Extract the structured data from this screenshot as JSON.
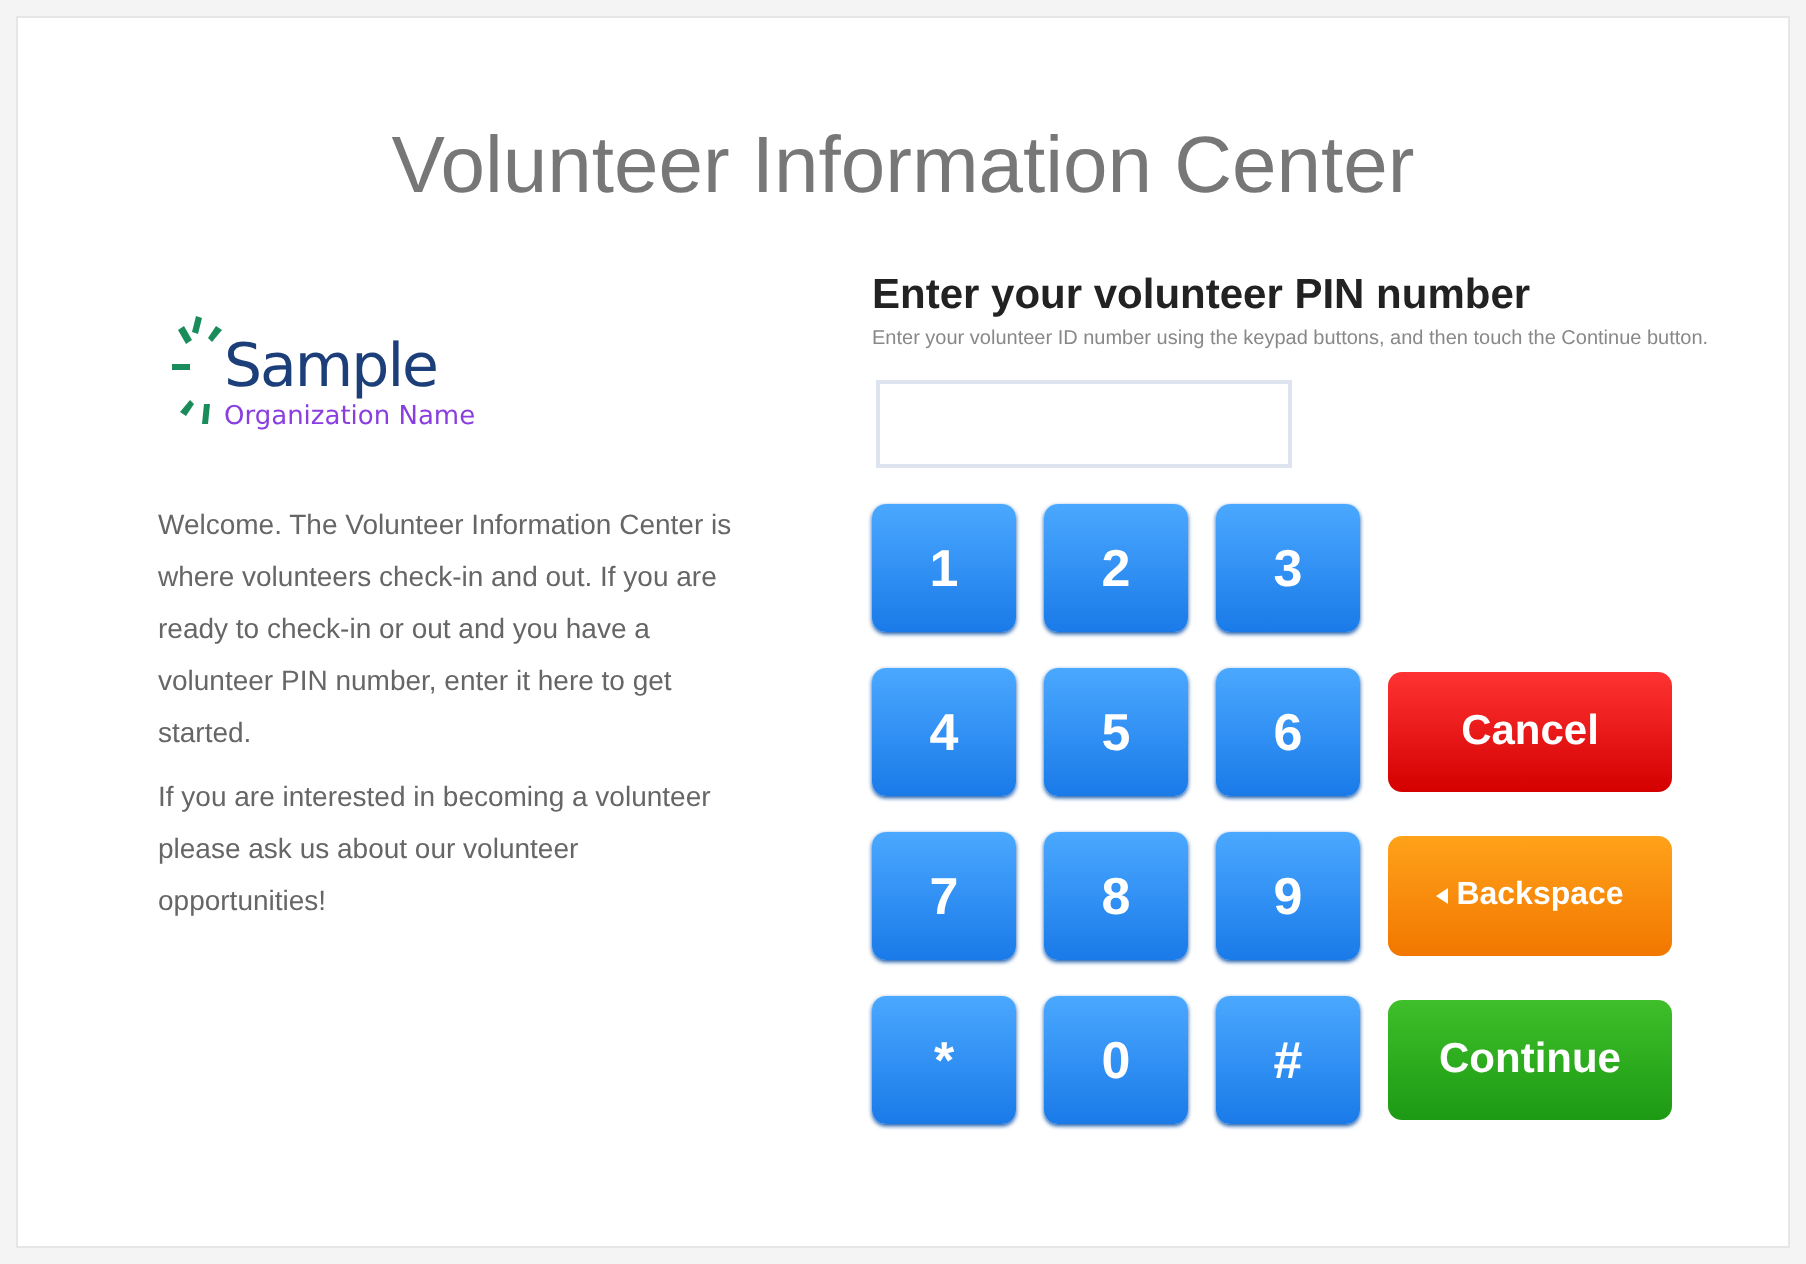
{
  "title": "Volunteer Information Center",
  "logo": {
    "name": "Sample",
    "subtitle": "Organization Name"
  },
  "intro": [
    "Welcome. The Volunteer Information Center is where volunteers check-in and out. If you are ready to check-in or out and you have a volunteer PIN number, enter it here to get started.",
    "If you are interested in becoming a volunteer please ask us about our volunteer opportunities!"
  ],
  "pin": {
    "heading": "Enter your volunteer PIN number",
    "hint": "Enter your volunteer ID number using the keypad buttons, and then touch the Continue button."
  },
  "keys": [
    "1",
    "2",
    "3",
    "4",
    "5",
    "6",
    "7",
    "8",
    "9",
    "*",
    "0",
    "#"
  ],
  "actions": [
    {
      "kind": "cancel",
      "label": "Cancel"
    },
    {
      "kind": "backspace",
      "label": "Backspace"
    },
    {
      "kind": "continue",
      "label": "Continue"
    }
  ]
}
